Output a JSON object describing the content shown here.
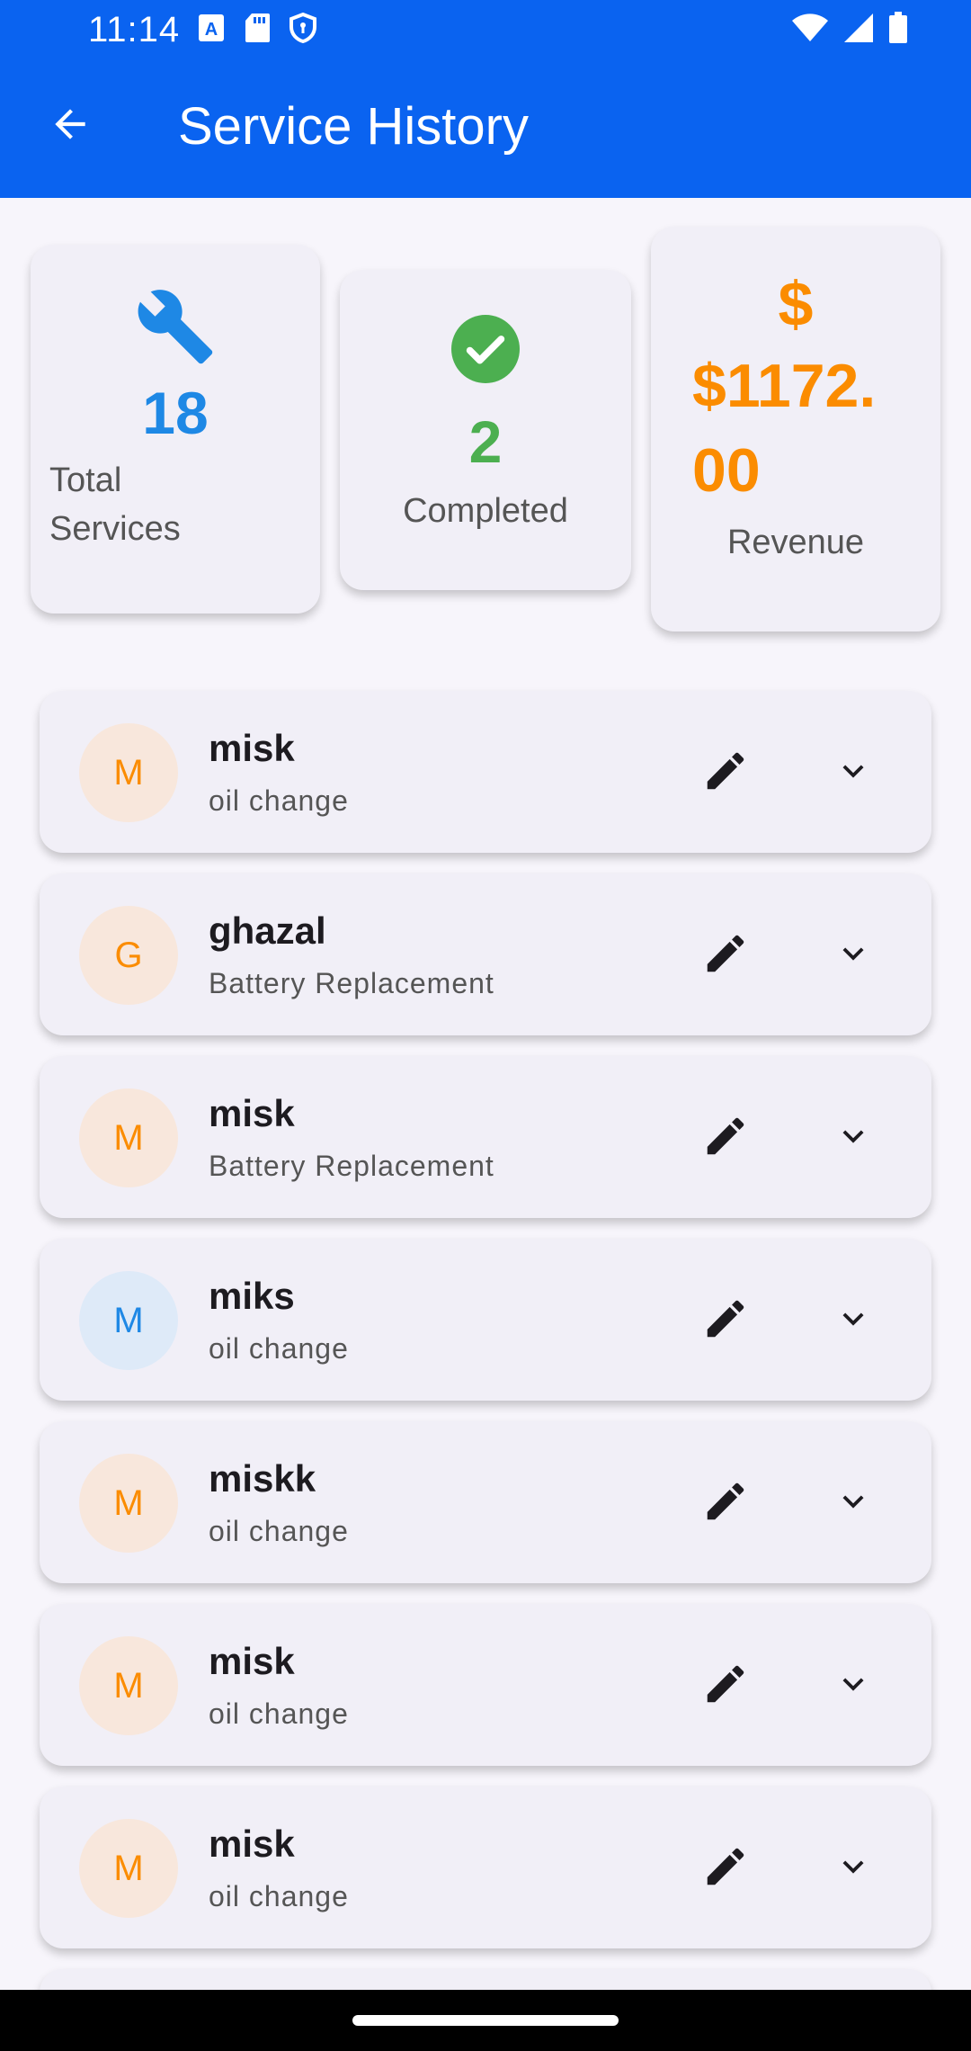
{
  "status_bar": {
    "time": "11:14",
    "icons_left": [
      "a-notification-icon",
      "sd-card-icon",
      "shield-icon"
    ],
    "icons_right": [
      "wifi-icon",
      "signal-icon",
      "battery-icon"
    ]
  },
  "app_bar": {
    "title": "Service History",
    "back_icon": "arrow-back-icon",
    "color": "#0a63f0"
  },
  "summary": {
    "total": {
      "icon": "wrench-icon",
      "value": "18",
      "label": "Total Services",
      "color": "#1e88e5"
    },
    "completed": {
      "icon": "check-circle-icon",
      "value": "2",
      "label": "Completed",
      "color": "#4caf50"
    },
    "revenue": {
      "icon": "dollar-icon",
      "symbol": "$",
      "value": "$1172.00",
      "label": "Revenue",
      "color": "#fb8c00"
    }
  },
  "services": [
    {
      "initial": "M",
      "name": "misk",
      "type": "oil change",
      "avatar_bg": "#f8e7dc",
      "avatar_fg": "#fb8c00"
    },
    {
      "initial": "G",
      "name": "ghazal",
      "type": "Battery Replacement",
      "avatar_bg": "#f8e7dc",
      "avatar_fg": "#fb8c00"
    },
    {
      "initial": "M",
      "name": "misk",
      "type": "Battery Replacement",
      "avatar_bg": "#f8e7dc",
      "avatar_fg": "#fb8c00"
    },
    {
      "initial": "M",
      "name": "miks",
      "type": "oil change",
      "avatar_bg": "#deeaf8",
      "avatar_fg": "#1e88e5"
    },
    {
      "initial": "M",
      "name": "miskk",
      "type": "oil change",
      "avatar_bg": "#f8e7dc",
      "avatar_fg": "#fb8c00"
    },
    {
      "initial": "M",
      "name": "misk",
      "type": "oil change",
      "avatar_bg": "#f8e7dc",
      "avatar_fg": "#fb8c00"
    },
    {
      "initial": "M",
      "name": "misk",
      "type": "oil change",
      "avatar_bg": "#f8e7dc",
      "avatar_fg": "#fb8c00"
    }
  ],
  "row_icons": {
    "edit": "pencil-icon",
    "expand": "chevron-down-icon"
  }
}
